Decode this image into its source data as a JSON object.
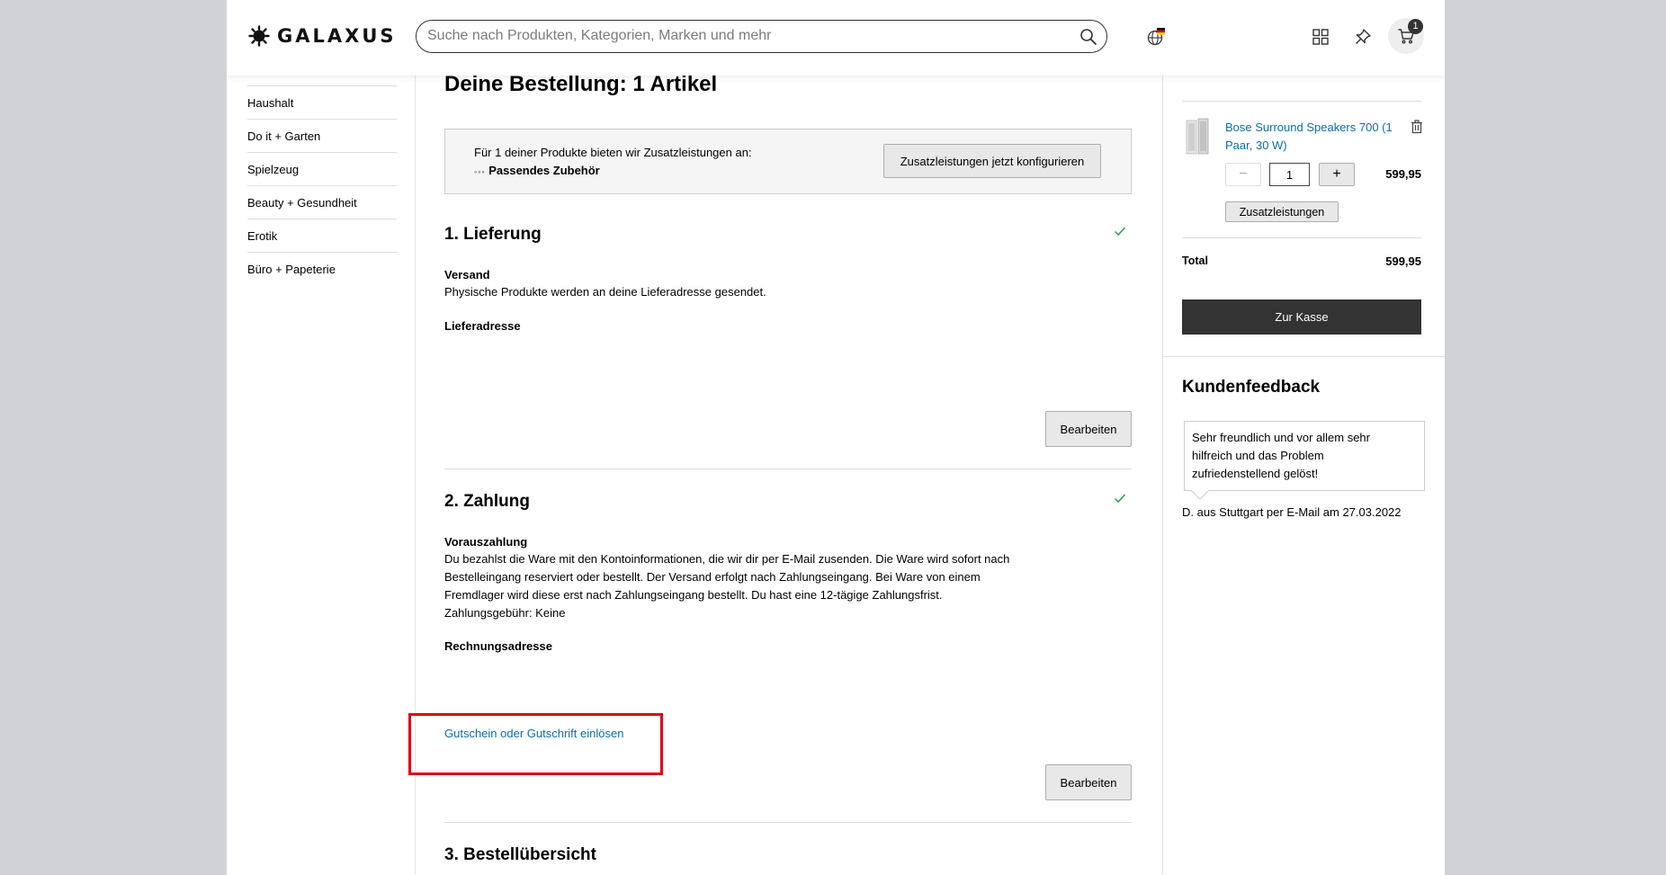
{
  "header": {
    "logo_text": "GALAXUS",
    "search": {
      "placeholder": "Suche nach Produkten, Kategorien, Marken und mehr",
      "value": ""
    },
    "cart_count": "1",
    "icons": [
      "globe-de-flag-icon",
      "grid-icon",
      "pin-icon",
      "cart-icon"
    ]
  },
  "sidebar": {
    "items": [
      {
        "label": "Haushalt"
      },
      {
        "label": "Do it + Garten"
      },
      {
        "label": "Spielzeug"
      },
      {
        "label": "Beauty + Gesundheit"
      },
      {
        "label": "Erotik"
      },
      {
        "label": "Büro + Papeterie"
      }
    ]
  },
  "main": {
    "title": "Deine Bestellung: 1 Artikel",
    "services_box": {
      "text": "Für 1 deiner Produkte bieten wir Zusatzleistungen an:",
      "highlight": "Passendes Zubehör",
      "button": "Zusatzleistungen jetzt konfigurieren"
    },
    "delivery": {
      "heading": "1. Lieferung",
      "shipping_label": "Versand",
      "shipping_text": "Physische Produkte werden an deine Lieferadresse gesendet.",
      "address_label": "Lieferadresse",
      "edit_button": "Bearbeiten"
    },
    "payment": {
      "heading": "2. Zahlung",
      "method_label": "Vorauszahlung",
      "method_text_lines": [
        "Du bezahlst die Ware mit den Kontoinformationen, die wir dir per E-Mail zusenden. Die Ware wird sofort nach",
        "Bestelleingang reserviert oder bestellt. Der Versand erfolgt nach Zahlungseingang. Bei Ware von einem",
        "Fremdlager wird diese erst nach Zahlungseingang bestellt. Du hast eine 12-tägige Zahlungsfrist.",
        "Zahlungsgebühr: Keine"
      ],
      "billing_label": "Rechnungsadresse",
      "voucher_link": "Gutschein oder Gutschrift einlösen",
      "edit_button": "Bearbeiten"
    },
    "overview": {
      "heading": "3. Bestellübersicht"
    }
  },
  "cart_summary": {
    "product_name": "Bose Surround Speakers 700 (1 Paar, 30 W)",
    "product_name_lines": [
      "Bose Surround Speakers 700 (1",
      "Paar, 30 W)"
    ],
    "quantity": "1",
    "minus": "−",
    "plus": "+",
    "price": "599,95",
    "services_button": "Zusatzleistungen",
    "total_label": "Total",
    "total_value": "599,95",
    "checkout_button": "Zur Kasse"
  },
  "feedback": {
    "title": "Kundenfeedback",
    "quote_lines": [
      "Sehr freundlich und vor allem sehr",
      "hilfreich und das Problem",
      "zufriedenstellend gelöst!"
    ],
    "author": "D. aus Stuttgart per E-Mail am 27.03.2022"
  },
  "colors": {
    "accent_link": "#0b6ea8",
    "check": "#2e9e48",
    "checkout_bg": "#333333",
    "highlight_frame": "#e3001b"
  }
}
